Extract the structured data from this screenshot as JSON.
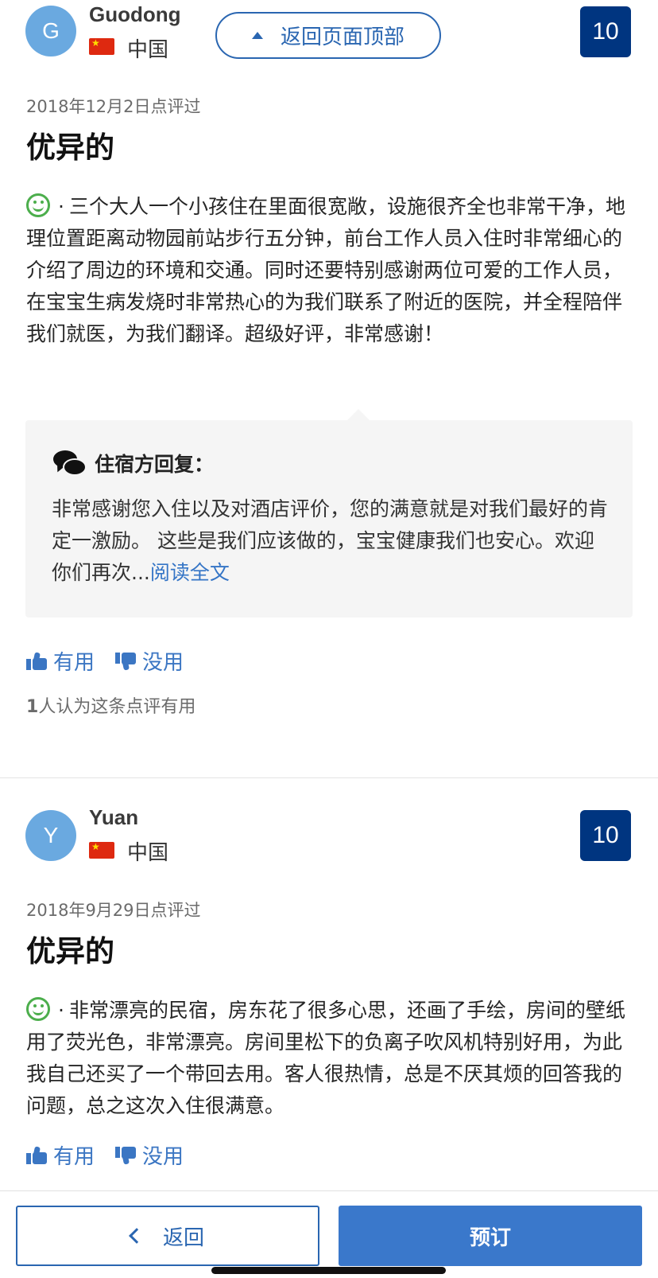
{
  "back_to_top_label": "返回页面顶部",
  "reviews": [
    {
      "avatar_initial": "G",
      "name": "Guodong",
      "country": "中国",
      "score": "10",
      "date": "2018年12月2日点评过",
      "title": "优异的",
      "sentiment_icon": "smiling-face-icon",
      "bullet": "·",
      "body": "三个大人一个小孩住在里面很宽敞，设施很齐全也非常干净，地理位置距离动物园前站步行五分钟，前台工作人员入住时非常细心的介绍了周边的环境和交通。同时还要特别感谢两位可爱的工作人员，在宝宝生病发烧时非常热心的为我们联系了附近的医院，并全程陪伴我们就医，为我们翻译。超级好评，非常感谢！",
      "host_reply": {
        "title": "住宿方回复：",
        "body": "非常感谢您入住以及对酒店评价，您的满意就是对我们最好的肯定一激励。 这些是我们应该做的，宝宝健康我们也安心。欢迎你们再次...",
        "read_more": "阅读全文"
      },
      "helpful_label": "有用",
      "not_helpful_label": "没用",
      "helpful_count_number": "1",
      "helpful_count_text": "人认为这条点评有用"
    },
    {
      "avatar_initial": "Y",
      "name": "Yuan",
      "country": "中国",
      "score": "10",
      "date": "2018年9月29日点评过",
      "title": "优异的",
      "sentiment_icon": "smiling-face-icon",
      "bullet": "·",
      "body": "非常漂亮的民宿，房东花了很多心思，还画了手绘，房间的壁纸用了荧光色，非常漂亮。房间里松下的负离子吹风机特别好用，为此我自己还买了一个带回去用。客人很热情，总是不厌其烦的回答我的问题，总之这次入住很满意。",
      "helpful_label": "有用",
      "not_helpful_label": "没用"
    }
  ],
  "bottom_bar": {
    "back_label": "返回",
    "book_label": "预订"
  },
  "colors": {
    "score_bg": "#003580",
    "accent_blue": "#2a66b1",
    "book_button": "#3a78cb",
    "smile_green": "#4cae4c"
  }
}
